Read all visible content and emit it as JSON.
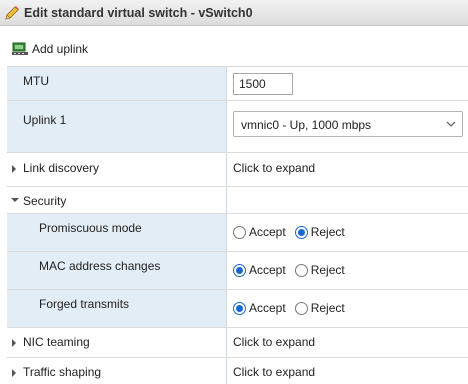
{
  "window": {
    "title": "Edit standard virtual switch - vSwitch0"
  },
  "toolbar": {
    "add_uplink_label": "Add uplink"
  },
  "rows": {
    "mtu": {
      "label": "MTU",
      "value": "1500"
    },
    "uplink1": {
      "label": "Uplink 1",
      "value": "vmnic0 - Up, 1000 mbps"
    },
    "link_discovery": {
      "label": "Link discovery",
      "action": "Click to expand"
    },
    "security": {
      "label": "Security"
    },
    "promiscuous": {
      "label": "Promiscuous mode",
      "accept": "Accept",
      "reject": "Reject",
      "selected": "Reject"
    },
    "mac_changes": {
      "label": "MAC address changes",
      "accept": "Accept",
      "reject": "Reject",
      "selected": "Accept"
    },
    "forged": {
      "label": "Forged transmits",
      "accept": "Accept",
      "reject": "Reject",
      "selected": "Accept"
    },
    "nic_teaming": {
      "label": "NIC teaming",
      "action": "Click to expand"
    },
    "traffic_shaping": {
      "label": "Traffic shaping",
      "action": "Click to expand"
    }
  },
  "colors": {
    "label_bg": "#e3edf5",
    "radio_accent": "#1a66d2"
  }
}
